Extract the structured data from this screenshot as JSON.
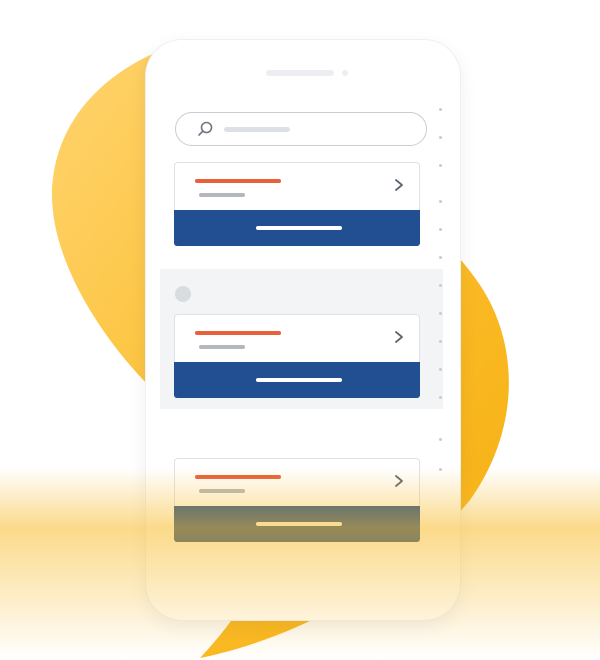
{
  "colors": {
    "blob_gradient_light": "#ffd470",
    "blob_gradient_dark": "#f6ae10",
    "card_button": "#214f91",
    "accent_line": "#e8603c",
    "muted_line": "#b3b8bf",
    "band": "#f3f4f5"
  },
  "icons": {
    "search": "search-icon",
    "chevron": "chevron-right-icon"
  },
  "search": {
    "placeholder": ""
  },
  "cards": [
    {
      "name": "result-card-1"
    },
    {
      "name": "result-card-2"
    },
    {
      "name": "result-card-3"
    }
  ]
}
